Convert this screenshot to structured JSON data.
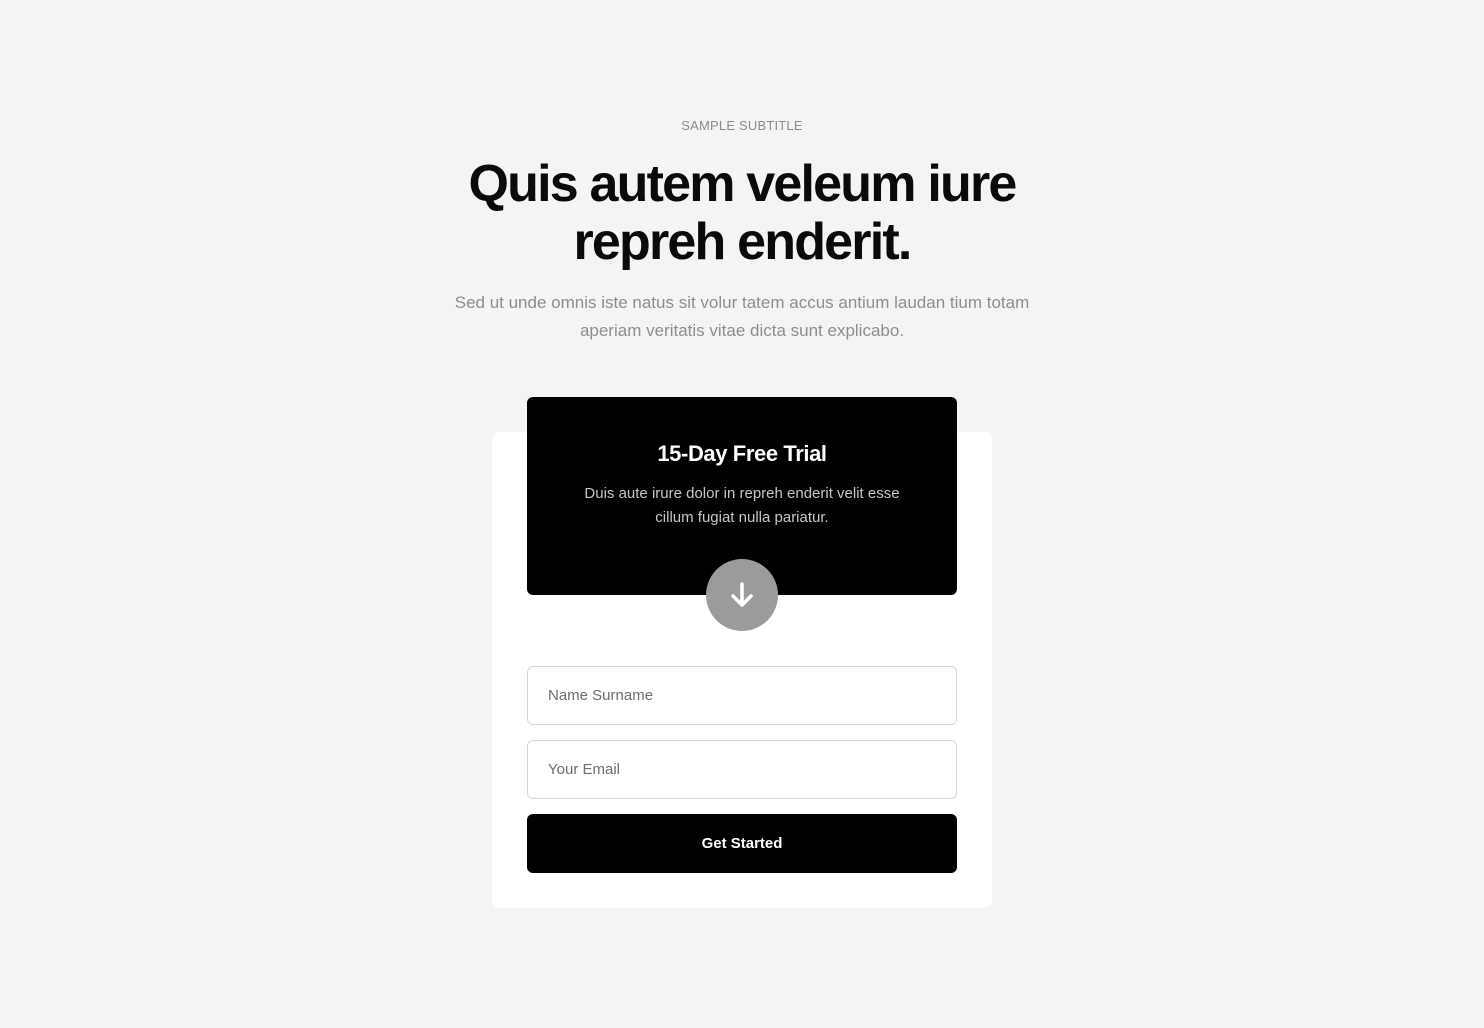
{
  "hero": {
    "subtitle": "SAMPLE SUBTITLE",
    "headline": "Quis autem veleum iure repreh enderit.",
    "lead": "Sed ut unde omnis iste natus sit volur tatem accus antium laudan tium totam aperiam veritatis vitae dicta sunt explicabo."
  },
  "promo": {
    "title": "15-Day Free Trial",
    "text": "Duis aute irure dolor in repreh enderit velit esse cillum fugiat nulla pariatur.",
    "icon": "arrow-down-icon"
  },
  "form": {
    "name_placeholder": "Name Surname",
    "email_placeholder": "Your Email",
    "submit_label": "Get Started"
  },
  "colors": {
    "background": "#f4f4f4",
    "card": "#ffffff",
    "promo": "#000000",
    "accent_circle": "#9b9b9b",
    "button": "#000000"
  }
}
